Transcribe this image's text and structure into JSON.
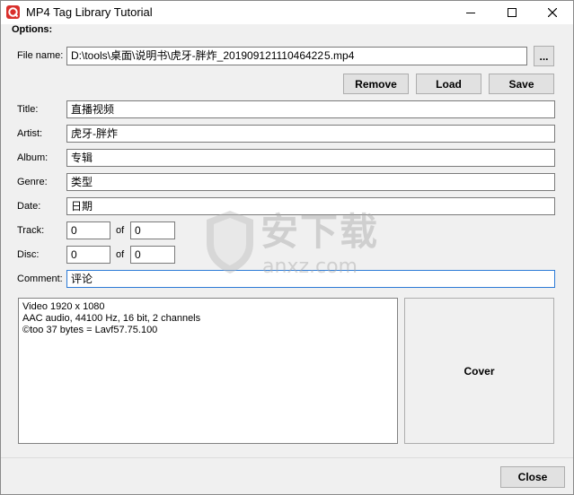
{
  "window": {
    "title": "MP4 Tag Library Tutorial"
  },
  "options_label": "Options:",
  "file": {
    "label": "File name:",
    "value": "D:\\tools\\桌面\\说明书\\虎牙-胖炸_20190912111046422 5.mp4",
    "browse_label": "..."
  },
  "actions": {
    "remove": "Remove",
    "load": "Load",
    "save": "Save"
  },
  "tags": {
    "title_label": "Title:",
    "title_value": "直播视频",
    "artist_label": "Artist:",
    "artist_value": "虎牙-胖炸",
    "album_label": "Album:",
    "album_value": "专辑",
    "genre_label": "Genre:",
    "genre_value": "类型",
    "date_label": "Date:",
    "date_value": "日期",
    "track_label": "Track:",
    "track_value": "0",
    "track_of_label": "of",
    "track_total": "0",
    "disc_label": "Disc:",
    "disc_value": "0",
    "disc_of_label": "of",
    "disc_total": "0",
    "comment_label": "Comment:",
    "comment_value": "评论"
  },
  "info_lines": [
    "Video 1920 x 1080",
    "AAC audio, 44100 Hz, 16 bit, 2 channels",
    "©too 37 bytes = Lavf57.75.100"
  ],
  "cover_label": "Cover",
  "close_label": "Close",
  "watermark": {
    "text": "安下载",
    "subtext": "anxz.com"
  }
}
